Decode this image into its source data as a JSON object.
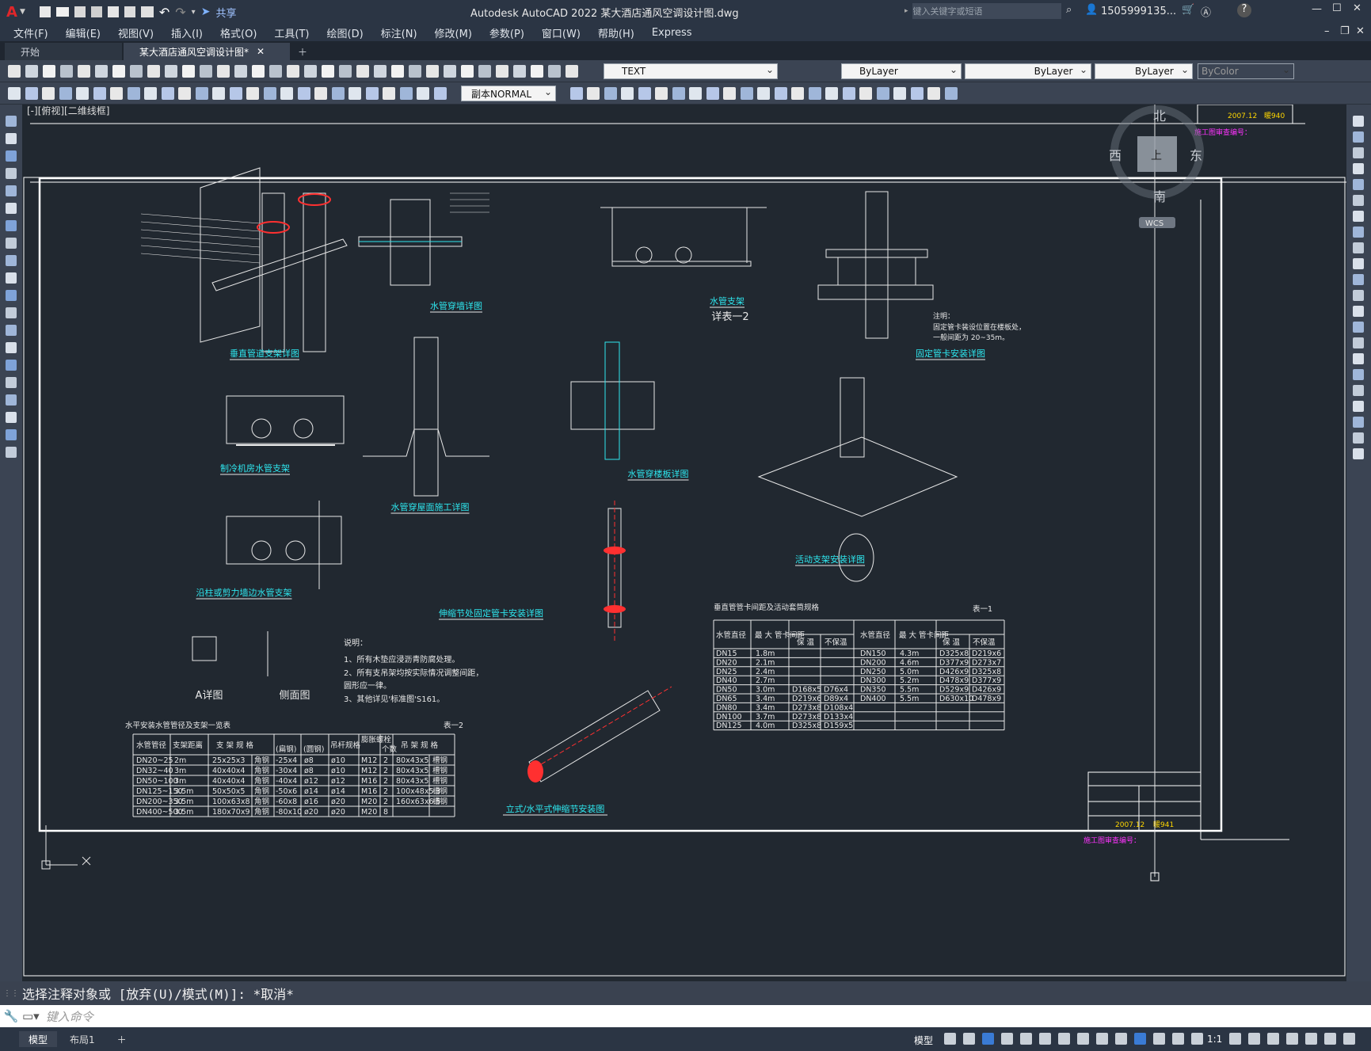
{
  "app": {
    "title": "Autodesk AutoCAD 2022    某大酒店通风空调设计图.dwg",
    "share_label": "共享",
    "search_placeholder": "键入关键字或短语",
    "user": "1505999135...",
    "logo_letter": "A"
  },
  "menu": [
    "文件(F)",
    "编辑(E)",
    "视图(V)",
    "插入(I)",
    "格式(O)",
    "工具(T)",
    "绘图(D)",
    "标注(N)",
    "修改(M)",
    "参数(P)",
    "窗口(W)",
    "帮助(H)",
    "Express"
  ],
  "tabs": [
    {
      "label": "开始",
      "active": false
    },
    {
      "label": "某大酒店通风空调设计图*",
      "active": true
    }
  ],
  "toolbar": {
    "text_style": "TEXT",
    "layer": "ByLayer",
    "linetype": "ByLayer",
    "lineweight": "ByLayer",
    "color": "ByColor",
    "dim_style": "副本NORMAL"
  },
  "viewport_label": "[-][俯视][二维线框]",
  "viewcube": {
    "north": "北",
    "south": "南",
    "east": "东",
    "west": "西",
    "top": "上",
    "wcs": "WCS"
  },
  "drawing": {
    "titles": [
      "垂直管道支架详图",
      "水管穿墙详图",
      "水管支架",
      "详表一2",
      "固定管卡安装详图",
      "制冷机房水管支架",
      "水管穿屋面施工详图",
      "水管穿楼板详图",
      "活动支架安装详图",
      "沿柱或剪力墙边水管支架",
      "伸缩节处固定管卡安装详图",
      "A详图",
      "侧面图",
      "立式/水平式伸缩节安装图"
    ],
    "notes_title": "说明：",
    "notes": [
      "1、所有木垫应浸沥青防腐处理。",
      "2、所有支吊架均按实际情况调整间距，",
      "   圆形应一律。",
      "3、其他详见'标准图'S161。"
    ],
    "fixed_note_title": "注明：",
    "fixed_note": [
      "固定管卡装设位置在楼板处，",
      "一般间距为 20~35m。"
    ],
    "sheet_numbers": [
      "暖940",
      "暖941"
    ],
    "sheet_date": "2007.12",
    "stamp_label": "施工图审查编号：",
    "tbl1_title": "水平安装水管管径及支架一览表",
    "tbl1_tag": "表一2",
    "tbl1_header": [
      "水管管径",
      "支架距离",
      "支 架 规 格",
      "",
      "(扁钢)",
      "(圆钢)",
      "吊杆规格",
      "膨胀螺栓",
      "个数",
      "吊 架 规 格"
    ],
    "tbl1_rows": [
      [
        "DN20~25",
        "2m",
        "25x25x3",
        "角钢",
        "-25x4",
        "ø8",
        "ø10",
        "M12",
        "2",
        "80x43x5",
        "槽钢"
      ],
      [
        "DN32~40",
        "3m",
        "40x40x4",
        "角钢",
        "-30x4",
        "ø8",
        "ø10",
        "M12",
        "2",
        "80x43x5",
        "槽钢"
      ],
      [
        "DN50~100",
        "3m",
        "40x40x4",
        "角钢",
        "-40x4",
        "ø12",
        "ø12",
        "M16",
        "2",
        "80x43x5",
        "槽钢"
      ],
      [
        "DN125~150",
        "3.5m",
        "50x50x5",
        "角钢",
        "-50x6",
        "ø14",
        "ø14",
        "M16",
        "2",
        "100x48x5.3",
        "槽钢"
      ],
      [
        "DN200~350",
        "3.5m",
        "100x63x8",
        "角钢",
        "-60x8",
        "ø16",
        "ø20",
        "M20",
        "2",
        "160x63x6.5",
        "槽钢"
      ],
      [
        "DN400~500",
        "3.5m",
        "180x70x9",
        "角钢",
        "-80x10",
        "ø20",
        "ø20",
        "M20",
        "8",
        "",
        ""
      ]
    ],
    "tbl2_title": "垂直管管卡间距及活动套筒规格",
    "tbl2_tag": "表一1",
    "tbl2_header": [
      "水管直径",
      "最 大 管卡间距",
      "保 温",
      "不保温",
      "水管直径",
      "最 大 管卡间距",
      "保 温",
      "不保温"
    ],
    "tbl2_rows": [
      [
        "DN15",
        "1.8m",
        "",
        "",
        "DN150",
        "4.3m",
        "D325x8",
        "D219x6"
      ],
      [
        "DN20",
        "2.1m",
        "",
        "",
        "DN200",
        "4.6m",
        "D377x9",
        "D273x7"
      ],
      [
        "DN25",
        "2.4m",
        "",
        "",
        "DN250",
        "5.0m",
        "D426x9",
        "D325x8"
      ],
      [
        "DN40",
        "2.7m",
        "",
        "",
        "DN300",
        "5.2m",
        "D478x9",
        "D377x9"
      ],
      [
        "DN50",
        "3.0m",
        "D168x5",
        "D76x4",
        "DN350",
        "5.5m",
        "D529x9",
        "D426x9"
      ],
      [
        "DN65",
        "3.4m",
        "D219x6",
        "D89x4",
        "DN400",
        "5.5m",
        "D630x10",
        "D478x9"
      ],
      [
        "DN80",
        "3.4m",
        "D273x8",
        "D108x4",
        "",
        "",
        "",
        ""
      ],
      [
        "DN100",
        "3.7m",
        "D273x8",
        "D133x4",
        "",
        "",
        "",
        ""
      ],
      [
        "DN125",
        "4.0m",
        "D325x8",
        "D159x5",
        "",
        "",
        "",
        ""
      ]
    ]
  },
  "command": {
    "history": "选择注释对象或 [放弃(U)/模式(M)]: *取消*",
    "placeholder": "键入命令"
  },
  "layout_tabs": [
    "模型",
    "布局1"
  ],
  "status": {
    "model": "模型",
    "scale": "1:1"
  }
}
